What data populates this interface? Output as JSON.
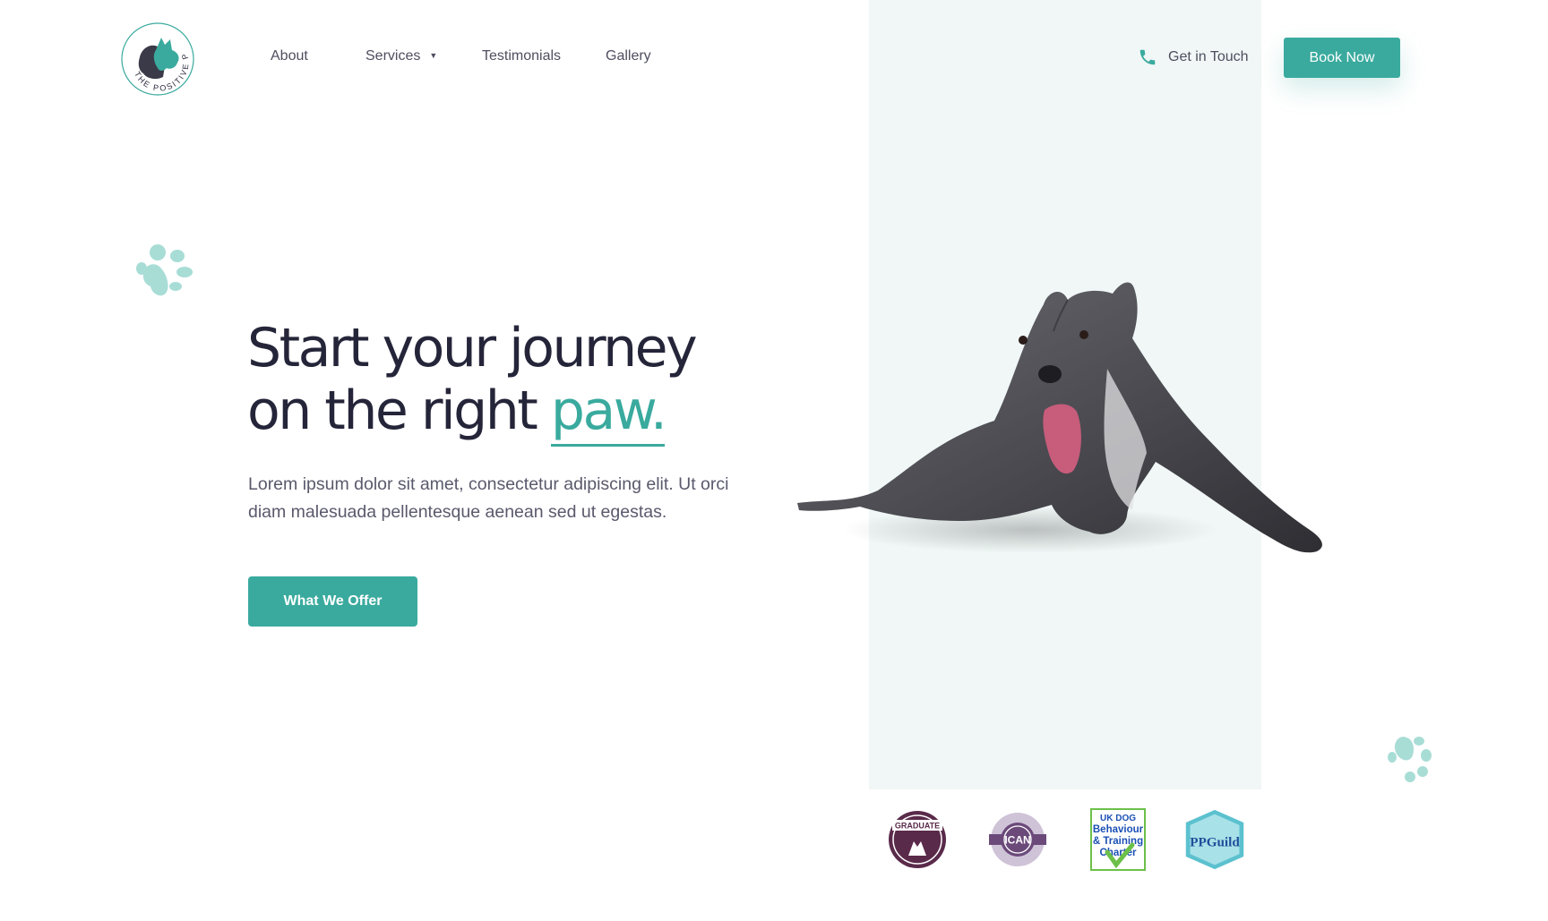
{
  "brand": {
    "logo_text": "THE POSITIVE PUP",
    "accent_color": "#3aaa9e",
    "dark_color": "#25253a",
    "panel_color": "#f0f7f6"
  },
  "nav": {
    "items": [
      {
        "label": "About"
      },
      {
        "label": "Services",
        "has_dropdown": true
      },
      {
        "label": "Testimonials"
      },
      {
        "label": "Gallery"
      }
    ],
    "contact_label": "Get in Touch",
    "contact_icon": "phone-icon",
    "cta_label": "Book Now"
  },
  "hero": {
    "title_line1": "Start your journey",
    "title_line2_prefix": "on the right",
    "title_accent": "paw.",
    "description": "Lorem ipsum dolor sit amet, consectetur adipiscing elit. Ut orci diam malesuada pellentesque aenean sed ut egestas.",
    "cta_label": "What We Offer"
  },
  "badges": [
    {
      "name": "graduate-badge",
      "text": "GRADUATE",
      "color": "#5a2a4a"
    },
    {
      "name": "ican-badge",
      "text": "ICAN",
      "color": "#6b4a7a"
    },
    {
      "name": "uk-dog-charter-badge",
      "text_lines": [
        "UK DOG",
        "Behaviour",
        "& Training",
        "Charter"
      ],
      "color": "#1a4fb4"
    },
    {
      "name": "pet-guild-badge",
      "text": "PPGuild",
      "color": "#5cc1cf"
    }
  ]
}
